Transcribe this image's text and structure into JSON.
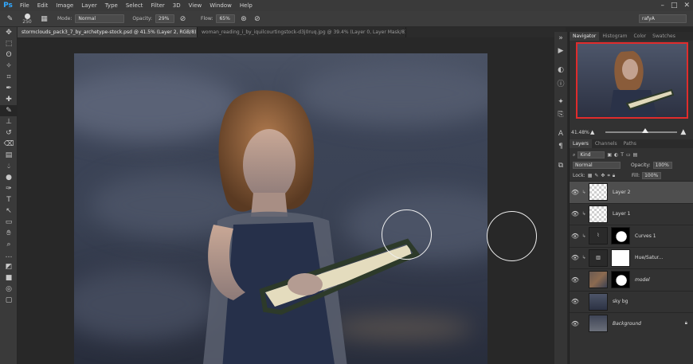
{
  "app": {
    "logo": "Ps",
    "workspace": "rafyA"
  },
  "menu": [
    "File",
    "Edit",
    "Image",
    "Layer",
    "Type",
    "Select",
    "Filter",
    "3D",
    "View",
    "Window",
    "Help"
  ],
  "window_controls": [
    "–",
    "□",
    "✕"
  ],
  "options": {
    "brush_size": "250",
    "mode_label": "Mode:",
    "mode_value": "Normal",
    "opacity_label": "Opacity:",
    "opacity_value": "29%",
    "flow_label": "Flow:",
    "flow_value": "65%"
  },
  "tabs": [
    {
      "label": "stormclouds_pack3_7_by_archetype-stock.psd @ 41.5% (Layer 2, RGB/8) *",
      "active": true
    },
    {
      "label": "woman_reading_i_by_iquilcourtingstock-d3j0ruq.jpg @ 39.4% (Layer 0, Layer Mask/8) *",
      "active": false
    }
  ],
  "tools": [
    "move-icon",
    "marquee-icon",
    "lasso-icon",
    "quick-select-icon",
    "crop-icon",
    "eyedropper-icon",
    "spot-heal-icon",
    "brush-icon",
    "stamp-icon",
    "history-brush-icon",
    "eraser-icon",
    "gradient-icon",
    "blur-icon",
    "dodge-icon",
    "pen-icon",
    "type-icon",
    "path-select-icon",
    "shape-icon",
    "hand-icon",
    "zoom-icon",
    "more-icon",
    "default-colors-icon",
    "color-swatches-icon",
    "quick-mask-icon",
    "screen-mode-icon"
  ],
  "navigator": {
    "tabs": [
      "Navigator",
      "Histogram",
      "Color",
      "Swatches"
    ],
    "zoom": "41.48%",
    "zoom_fraction": 0.55
  },
  "layers": {
    "tabs": [
      "Layers",
      "Channels",
      "Paths"
    ],
    "filter_kind": "Kind",
    "blend_mode": "Normal",
    "opacity_label": "Opacity:",
    "opacity_value": "100%",
    "lock_label": "Lock:",
    "fill_label": "Fill:",
    "fill_value": "100%",
    "items": [
      {
        "name": "Layer 2",
        "thumb": "checker",
        "mask": false,
        "selected": true,
        "clip": true
      },
      {
        "name": "Layer 1",
        "thumb": "checker",
        "mask": false,
        "selected": false,
        "clip": true
      },
      {
        "name": "Curves 1",
        "thumb": "curves",
        "mask": true,
        "selected": false,
        "clip": true
      },
      {
        "name": "Hue/Satur...",
        "thumb": "huesat",
        "mask": true,
        "selected": false,
        "clip": true
      },
      {
        "name": "model",
        "thumb": "photo",
        "mask": true,
        "selected": false,
        "clip": false
      },
      {
        "name": "sky bg",
        "thumb": "sky",
        "mask": false,
        "selected": false,
        "clip": false
      },
      {
        "name": "Background",
        "thumb": "bg",
        "mask": false,
        "selected": false,
        "clip": false,
        "locked": true
      }
    ]
  }
}
